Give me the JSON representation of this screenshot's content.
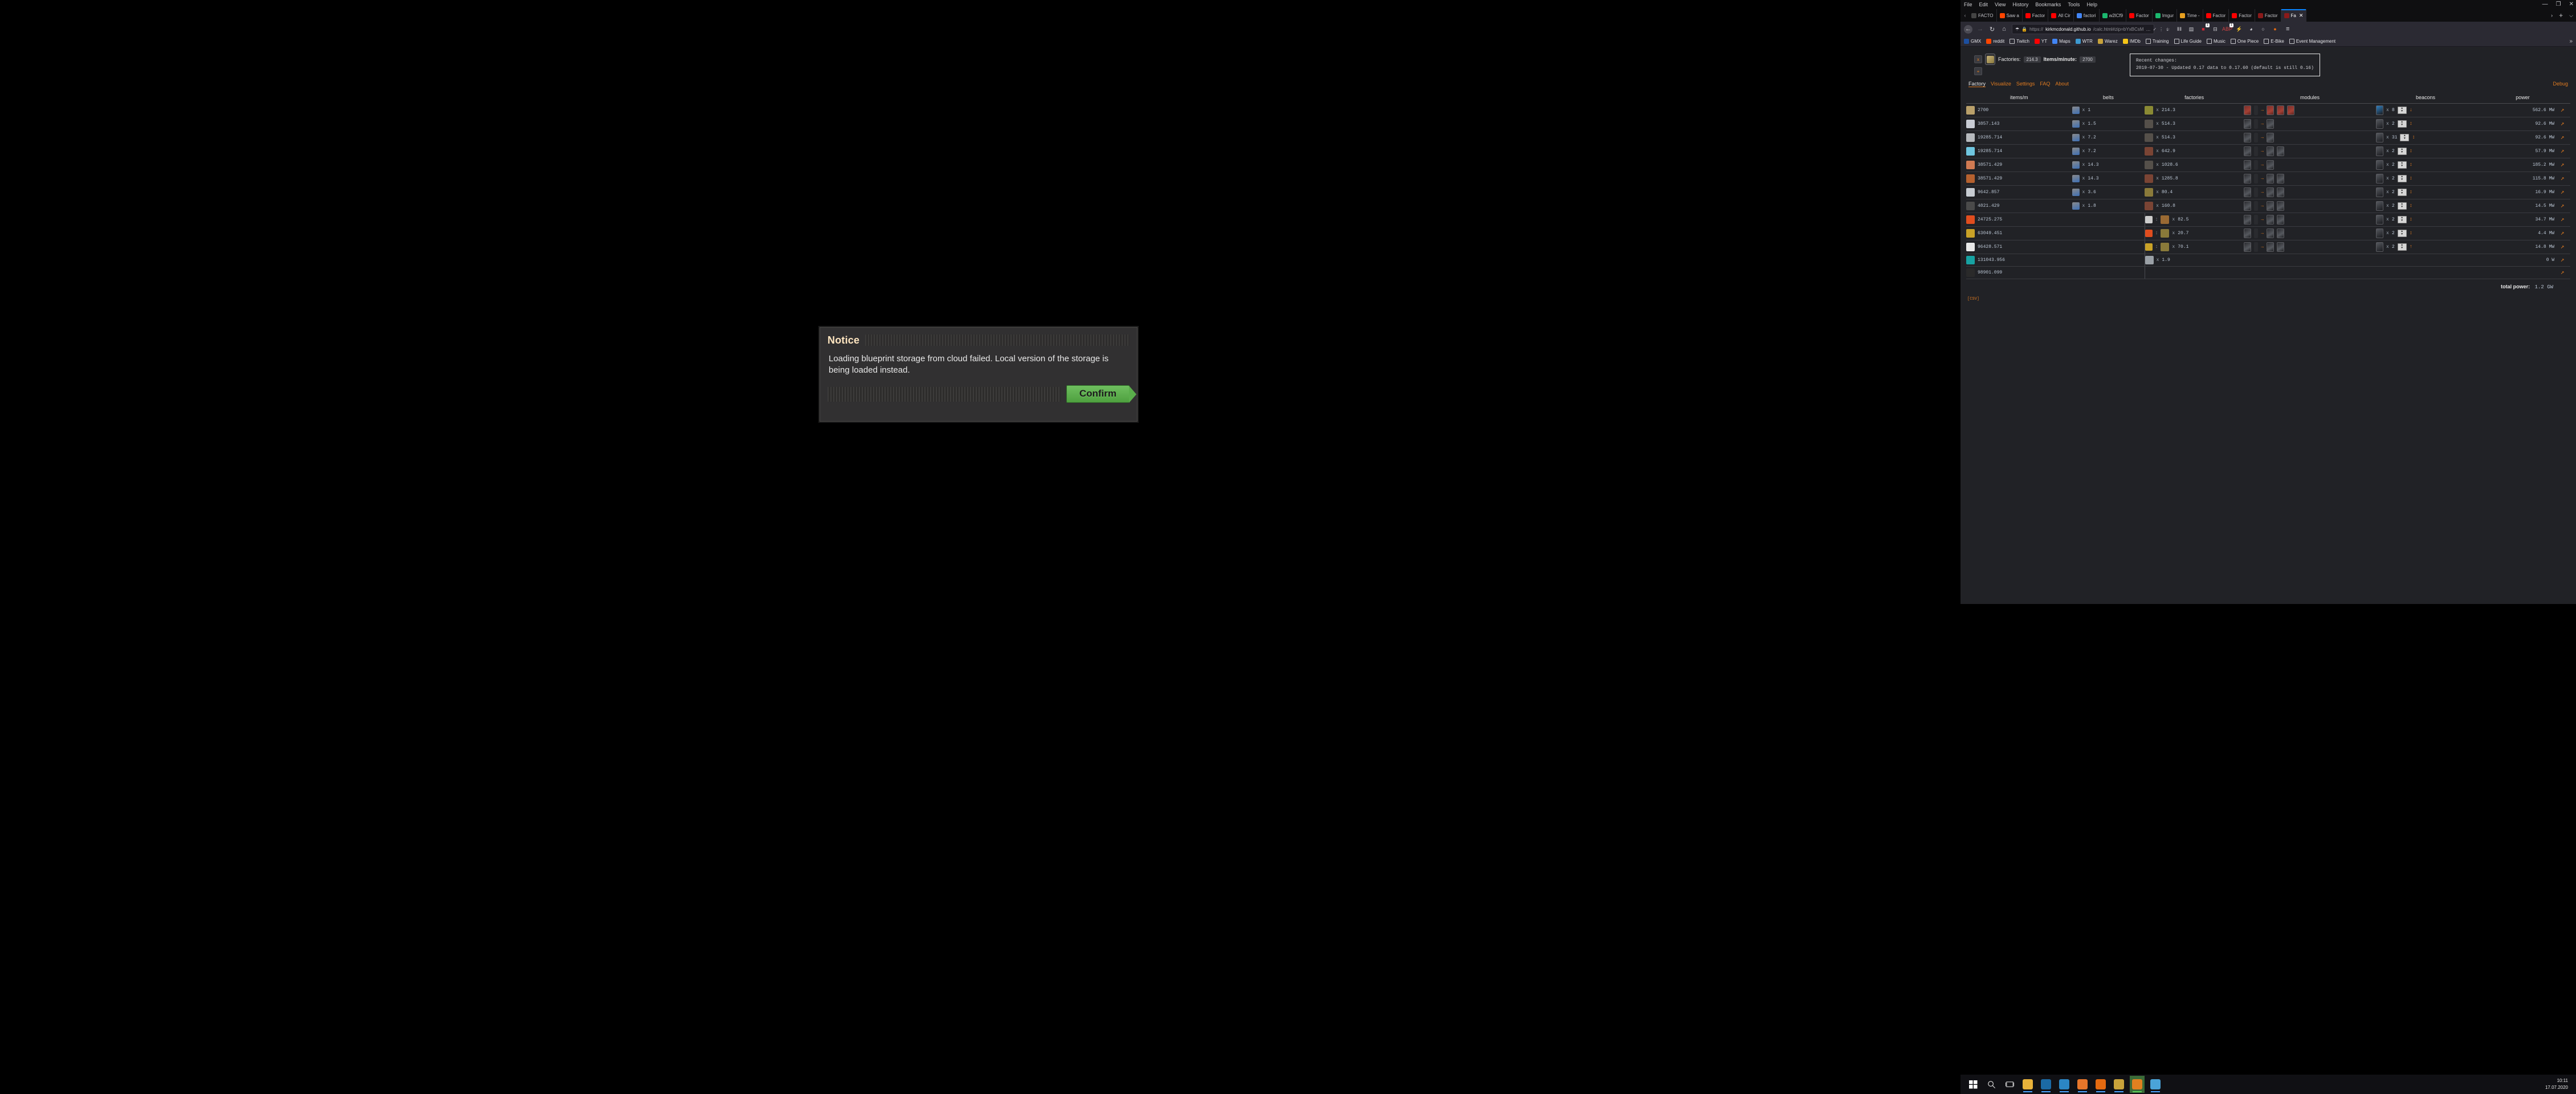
{
  "desktop": {
    "background": "#000000"
  },
  "notice": {
    "title": "Notice",
    "body": "Loading blueprint storage from cloud failed. Local version of the storage is being loaded instead.",
    "confirm_label": "Confirm",
    "confirm_color": "#5aae4b"
  },
  "browser": {
    "menu": [
      "File",
      "Edit",
      "View",
      "History",
      "Bookmarks",
      "Tools",
      "Help"
    ],
    "window_controls": {
      "minimize": "—",
      "restore": "❐",
      "close": "✕"
    },
    "tab_scroll_left": "‹",
    "tab_scroll_right": "›",
    "new_tab": "+",
    "tab_list": "⌵",
    "tabs": [
      {
        "title": "FACTO",
        "favicon": "#444444",
        "active": false
      },
      {
        "title": "Saw a",
        "favicon": "#ff4500",
        "active": false
      },
      {
        "title": "Factor",
        "favicon": "#ff0000",
        "active": false
      },
      {
        "title": "All Cir",
        "favicon": "#ff0000",
        "active": false
      },
      {
        "title": "factori",
        "favicon": "#4285f4",
        "active": false
      },
      {
        "title": "w2lCf9",
        "favicon": "#1bb76e",
        "active": false
      },
      {
        "title": "Factor",
        "favicon": "#ff0000",
        "active": false
      },
      {
        "title": "Imgur",
        "favicon": "#1bb76e",
        "active": false
      },
      {
        "title": "Time -",
        "favicon": "#e8a020",
        "active": false
      },
      {
        "title": "Factor",
        "favicon": "#ff0000",
        "active": false
      },
      {
        "title": "Factor",
        "favicon": "#ff0000",
        "active": false
      },
      {
        "title": "Factor",
        "favicon": "#8b1a1a",
        "active": false
      },
      {
        "title": "Fa",
        "favicon": "#8b1a1a",
        "active": true,
        "close": "✕"
      }
    ],
    "nav": {
      "back": "←",
      "forward": "→",
      "reload": "↻",
      "home": "⌂",
      "shield_icon": "shield",
      "lock_icon": "ὑ2",
      "url_scheme": "https://",
      "url_domain": "kirkmcdonald.github.io",
      "url_path": "/calc.html#zip=bYxBCsM",
      "page_actions": "…",
      "reader": "⋮",
      "pocket": "✓",
      "bookmark_star": "☆"
    },
    "toolbar_icons": [
      {
        "name": "downloads-icon",
        "glyph": "↓",
        "color": "#cfcfd4",
        "badge": ""
      },
      {
        "name": "library-icon",
        "glyph": "Ⅱ‖",
        "color": "#cfcfd4",
        "badge": ""
      },
      {
        "name": "sidebar-icon",
        "glyph": "▤",
        "color": "#cfcfd4",
        "badge": ""
      },
      {
        "name": "ublock-icon",
        "glyph": "■",
        "color": "#cc2936",
        "badge": "1"
      },
      {
        "name": "container-icon",
        "glyph": "⊟",
        "color": "#cfcfd4",
        "badge": ""
      },
      {
        "name": "adblock-icon",
        "glyph": "ABP",
        "color": "#d14242",
        "badge": "1"
      },
      {
        "name": "noscript-icon",
        "glyph": "⚡",
        "color": "#e8c51f",
        "badge": ""
      },
      {
        "name": "privacy-badger-icon",
        "glyph": "◕",
        "color": "#cfcfd4",
        "badge": ""
      },
      {
        "name": "account-icon",
        "glyph": "○",
        "color": "#cfcfd4",
        "badge": ""
      },
      {
        "name": "firefox-icon",
        "glyph": "●",
        "color": "#e56a10",
        "badge": ""
      }
    ],
    "menu_button": "≡",
    "bookmarks": [
      {
        "label": "GMX",
        "icon": "#1c4fa0",
        "type": "site"
      },
      {
        "label": "reddit",
        "icon": "#ff4500",
        "type": "site"
      },
      {
        "label": "Twitch",
        "icon": "folder",
        "type": "folder"
      },
      {
        "label": "YT",
        "icon": "#ff0000",
        "type": "site"
      },
      {
        "label": "Maps",
        "icon": "#4285f4",
        "type": "site"
      },
      {
        "label": "WTR",
        "icon": "#3d9ad1",
        "type": "site"
      },
      {
        "label": "Warez",
        "icon": "#c8a23a",
        "type": "site"
      },
      {
        "label": "IMDb",
        "icon": "#f5c518",
        "type": "site"
      },
      {
        "label": "Training",
        "icon": "folder",
        "type": "folder"
      },
      {
        "label": "Life Guide",
        "icon": "folder",
        "type": "folder"
      },
      {
        "label": "Music",
        "icon": "folder",
        "type": "folder"
      },
      {
        "label": "One Piece",
        "icon": "folder",
        "type": "folder"
      },
      {
        "label": "E-Bike",
        "icon": "folder",
        "type": "folder"
      },
      {
        "label": "Event Management",
        "icon": "folder",
        "type": "folder"
      }
    ],
    "bookmarks_overflow": "»"
  },
  "calculator": {
    "totals": {
      "remove_button": "x",
      "add_button": "+",
      "factories_label": "Factories:",
      "factories_value": "214.3",
      "items_per_minute_label": "Items/minute:",
      "items_per_minute_value": "2700"
    },
    "recent_changes": {
      "heading": "Recent changes:",
      "line": "2019-07-30 - Updated 0.17 data to 0.17.60 (default is still 0.16)"
    },
    "tabs": [
      {
        "label": "Factory",
        "active": true
      },
      {
        "label": "Visualize",
        "active": false
      },
      {
        "label": "Settings",
        "active": false
      },
      {
        "label": "FAQ",
        "active": false
      },
      {
        "label": "About",
        "active": false
      }
    ],
    "debug_label": "Debug",
    "columns": [
      "items/m",
      "belts",
      "factories",
      "modules",
      "beacons",
      "power"
    ],
    "link_icon": "↗",
    "rows": [
      {
        "item_color": "#b9a06a",
        "items": "2700",
        "belt_color": "#3d6fb5",
        "belt_mult": "x",
        "belt_value": "1",
        "factory_color": "#8a8a34",
        "factory_mult": "x",
        "factory_value": "214.3",
        "modules": [
          "prod",
          "gap",
          "prod",
          "prod",
          "prod"
        ],
        "module_arrow": "→",
        "beacon_color": "#2f7fc0",
        "beacon_mult": "x",
        "beacon_value": "8",
        "beacon_dir": "↓",
        "power": "562.6 MW",
        "has_belt": true
      },
      {
        "item_color": "#c8ccd4",
        "items": "3857.143",
        "belt_color": "#3d6fb5",
        "belt_mult": "x",
        "belt_value": "1.5",
        "factory_color": "#55504a",
        "factory_mult": "x",
        "factory_value": "514.3",
        "modules": [
          "eff",
          "gap",
          "eff"
        ],
        "module_arrow": "→",
        "beacon_color": "#55585e",
        "beacon_mult": "x",
        "beacon_value": "2",
        "beacon_dir": "↕",
        "power": "92.6 MW",
        "has_belt": true
      },
      {
        "item_color": "#b6b9bd",
        "items": "19285.714",
        "belt_color": "#3d6fb5",
        "belt_mult": "x",
        "belt_value": "7.2",
        "factory_color": "#55504a",
        "factory_mult": "x",
        "factory_value": "514.3",
        "modules": [
          "eff",
          "gap",
          "eff"
        ],
        "module_arrow": "→",
        "beacon_color": "#55585e",
        "beacon_mult": "x",
        "beacon_value": "31",
        "beacon_dir": "↕",
        "power": "92.6 MW",
        "has_belt": true
      },
      {
        "item_color": "#6fc6e0",
        "items": "19285.714",
        "belt_color": "#3d6fb5",
        "belt_mult": "x",
        "belt_value": "7.2",
        "factory_color": "#7a4434",
        "factory_mult": "x",
        "factory_value": "642.9",
        "modules": [
          "eff",
          "gap",
          "eff",
          "eff"
        ],
        "module_arrow": "→",
        "beacon_color": "#55585e",
        "beacon_mult": "x",
        "beacon_value": "2",
        "beacon_dir": "↕",
        "power": "57.9 MW",
        "has_belt": true
      },
      {
        "item_color": "#d07a52",
        "items": "38571.429",
        "belt_color": "#3d6fb5",
        "belt_mult": "x",
        "belt_value": "14.3",
        "factory_color": "#55504a",
        "factory_mult": "x",
        "factory_value": "1028.6",
        "modules": [
          "eff",
          "gap",
          "eff"
        ],
        "module_arrow": "→",
        "beacon_color": "#55585e",
        "beacon_mult": "x",
        "beacon_value": "2",
        "beacon_dir": "↕",
        "power": "185.2 MW",
        "has_belt": true
      },
      {
        "item_color": "#b5612f",
        "items": "38571.429",
        "belt_color": "#3d6fb5",
        "belt_mult": "x",
        "belt_value": "14.3",
        "factory_color": "#7a4434",
        "factory_mult": "x",
        "factory_value": "1285.8",
        "modules": [
          "eff",
          "gap",
          "eff",
          "eff"
        ],
        "module_arrow": "→",
        "beacon_color": "#55585e",
        "beacon_mult": "x",
        "beacon_value": "2",
        "beacon_dir": "↕",
        "power": "115.8 MW",
        "has_belt": true
      },
      {
        "item_color": "#c7ccd2",
        "items": "9642.857",
        "belt_color": "#3d6fb5",
        "belt_mult": "x",
        "belt_value": "3.6",
        "factory_color": "#8a7a3a",
        "factory_mult": "x",
        "factory_value": "80.4",
        "modules": [
          "eff",
          "gap",
          "eff",
          "eff"
        ],
        "module_arrow": "→",
        "beacon_color": "#55585e",
        "beacon_mult": "x",
        "beacon_value": "2",
        "beacon_dir": "↕",
        "power": "16.9 MW",
        "has_belt": true
      },
      {
        "item_color": "#4a4a4a",
        "items": "4821.429",
        "belt_color": "#3d6fb5",
        "belt_mult": "x",
        "belt_value": "1.8",
        "factory_color": "#7a4434",
        "factory_mult": "x",
        "factory_value": "160.8",
        "modules": [
          "eff",
          "gap",
          "eff",
          "eff"
        ],
        "module_arrow": "→",
        "beacon_color": "#55585e",
        "beacon_mult": "x",
        "beacon_value": "2",
        "beacon_dir": "↕",
        "power": "14.5 MW",
        "has_belt": true
      },
      {
        "item_color": "#e04d1e",
        "items": "24725.275",
        "belt_color": "",
        "belt_mult": "",
        "belt_value": "",
        "factory_color": "#9a6a33",
        "factory_mult": "x",
        "factory_value": "82.5",
        "factory_prefix_color": "#cccccc",
        "modules": [
          "eff",
          "gap",
          "eff",
          "eff"
        ],
        "module_arrow": "→",
        "beacon_color": "#55585e",
        "beacon_mult": "x",
        "beacon_value": "2",
        "beacon_dir": "↕",
        "power": "34.7 MW",
        "has_belt": false
      },
      {
        "item_color": "#c9a227",
        "items": "63049.451",
        "belt_color": "",
        "belt_mult": "",
        "belt_value": "",
        "factory_color": "#8a7a3a",
        "factory_mult": "x",
        "factory_value": "20.7",
        "factory_prefix_color": "#e04d1e",
        "modules": [
          "eff",
          "gap",
          "eff",
          "eff"
        ],
        "module_arrow": "→",
        "beacon_color": "#55585e",
        "beacon_mult": "x",
        "beacon_value": "2",
        "beacon_dir": "↕",
        "power": "4.4 MW",
        "has_belt": false
      },
      {
        "item_color": "#e8e8e8",
        "items": "96428.571",
        "belt_color": "",
        "belt_mult": "",
        "belt_value": "",
        "factory_color": "#8a7a3a",
        "factory_mult": "x",
        "factory_value": "70.1",
        "factory_prefix_color": "#c9a227",
        "modules": [
          "eff",
          "gap",
          "eff",
          "eff"
        ],
        "module_arrow": "→",
        "beacon_color": "#55585e",
        "beacon_mult": "x",
        "beacon_value": "2",
        "beacon_dir": "↑",
        "power": "14.8 MW",
        "has_belt": false
      },
      {
        "item_color": "#17a2a2",
        "items": "131043.956",
        "belt_color": "",
        "belt_mult": "",
        "belt_value": "",
        "factory_color": "#9aa0a6",
        "factory_mult": "x",
        "factory_value": "1.9",
        "modules": [],
        "module_arrow": "",
        "beacon_color": "",
        "beacon_mult": "",
        "beacon_value": "",
        "beacon_dir": "",
        "power": "0   W",
        "has_belt": false
      },
      {
        "item_color": "#2a2a2a",
        "items": "98901.099",
        "belt_color": "",
        "belt_mult": "",
        "belt_value": "",
        "factory_color": "",
        "factory_mult": "",
        "factory_value": "",
        "modules": [],
        "module_arrow": "",
        "beacon_color": "",
        "beacon_mult": "",
        "beacon_value": "",
        "beacon_dir": "",
        "power": "",
        "has_belt": false
      }
    ],
    "total_power_label": "total power:",
    "total_power_value": "1.2 GW",
    "csv_label": "[CSV]"
  },
  "taskbar": {
    "start_icon": "start",
    "search_icon": "search",
    "taskview_icon": "task-view",
    "apps": [
      {
        "name": "file-explorer",
        "color": "#e8b23a",
        "running": true
      },
      {
        "name": "steam",
        "color": "#1b6aa5",
        "running": true
      },
      {
        "name": "thunderbird",
        "color": "#2b86c5",
        "running": true
      },
      {
        "name": "vlc",
        "color": "#e8762a",
        "running": true
      },
      {
        "name": "firefox",
        "color": "#e56a10",
        "running": true
      },
      {
        "name": "lute-app",
        "color": "#c8a23a",
        "running": true
      },
      {
        "name": "factorio",
        "color": "#e08020",
        "running": true,
        "active": true
      },
      {
        "name": "paint-net",
        "color": "#4aa3d8",
        "running": true
      }
    ],
    "clock_time": "10:11",
    "clock_date": "17.07.2020"
  }
}
